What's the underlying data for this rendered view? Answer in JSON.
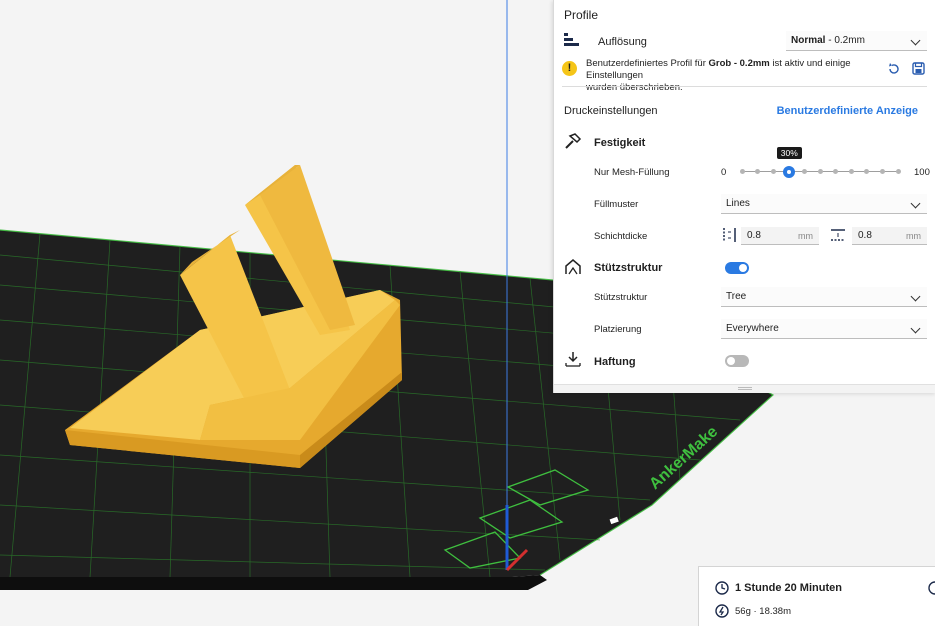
{
  "profile": {
    "section_title": "Profile",
    "resolution_label": "Auflösung",
    "resolution_value_bold": "Normal",
    "resolution_value_rest": " - 0.2mm",
    "warning_prefix": "Benutzerdefiniertes Profil für ",
    "warning_profile": "Grob - 0.2mm",
    "warning_suffix_line1": " ist aktiv und einige Einstellungen",
    "warning_line2": "wurden überschrieben."
  },
  "print_settings": {
    "title": "Druckeinstellungen",
    "custom_view_link": "Benutzerdefinierte Anzeige"
  },
  "strength": {
    "title": "Festigkeit",
    "infill_label": "Nur Mesh-Füllung",
    "infill_min": "0",
    "infill_max": "100",
    "infill_value": 30,
    "infill_tooltip": "30%",
    "pattern_label": "Füllmuster",
    "pattern_value": "Lines",
    "thickness_label": "Schichtdicke",
    "wall_thickness": "0.8",
    "wall_unit": "mm",
    "topbottom_thickness": "0.8",
    "topbottom_unit": "mm"
  },
  "support": {
    "title": "Stützstruktur",
    "enabled": true,
    "type_label": "Stützstruktur",
    "type_value": "Tree",
    "placement_label": "Platzierung",
    "placement_value": "Everywhere"
  },
  "adhesion": {
    "title": "Haftung",
    "enabled": false
  },
  "estimate": {
    "time": "1 Stunde 20 Minuten",
    "material": "56g · 18.38m"
  },
  "bed": {
    "brand": "AnkerMake"
  },
  "colors": {
    "accent": "#2a7ae2",
    "model": "#f2c14e",
    "bed_grid": "#3fbf3f",
    "warning": "#f5c518"
  }
}
